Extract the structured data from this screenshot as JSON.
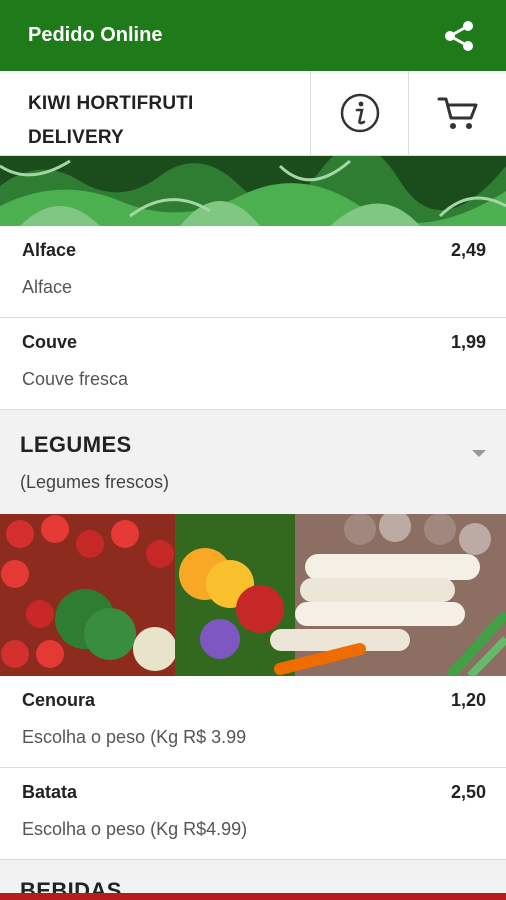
{
  "appbar": {
    "title": "Pedido Online",
    "share_icon": "share-icon"
  },
  "store": {
    "name_line1": "KIWI HORTIFRUTI",
    "name_line2": "DELIVERY",
    "info_icon": "info-icon",
    "cart_icon": "cart-icon"
  },
  "items_top": [
    {
      "name": "Alface",
      "desc": "Alface",
      "price": "2,49"
    },
    {
      "name": "Couve",
      "desc": "Couve fresca",
      "price": "1,99"
    }
  ],
  "category": {
    "title": "LEGUMES",
    "subtitle": "(Legumes frescos)"
  },
  "items_bottom": [
    {
      "name": "Cenoura",
      "desc": "Escolha o peso (Kg R$ 3.99",
      "price": "1,20"
    },
    {
      "name": "Batata",
      "desc": "Escolha o peso (Kg R$4.99)",
      "price": "2,50"
    }
  ],
  "next_category": {
    "title": "BEBIDAS"
  },
  "colors": {
    "appbar": "#1f7a1a",
    "bottom_bar": "#b71c1c"
  }
}
